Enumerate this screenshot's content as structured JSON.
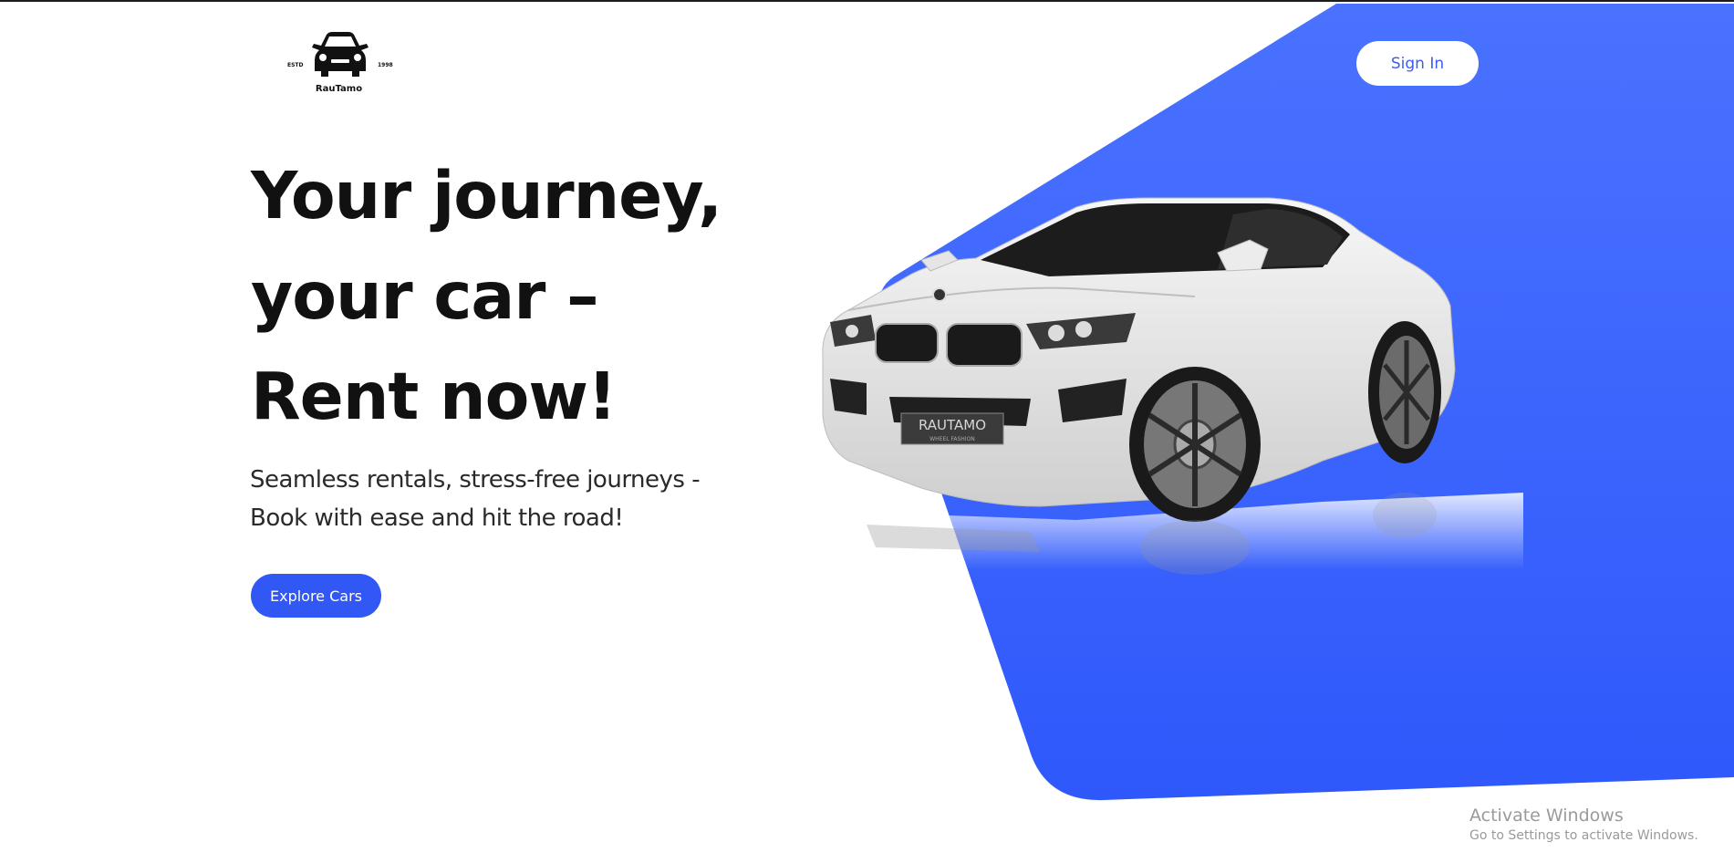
{
  "logo": {
    "estd": "ESTD",
    "year": "1998",
    "brand": "RauTamo",
    "icon": "car-front-icon"
  },
  "header": {
    "sign_in_label": "Sign In"
  },
  "hero": {
    "headline_lines": [
      "Your journey,",
      "your car –",
      "Rent now!"
    ],
    "subtitle_lines": [
      "Seamless rentals, stress-free journeys -",
      "Book with ease and hit the road!"
    ],
    "cta_label": "Explore Cars",
    "plate_text": "RAUTAMO",
    "plate_subtext": "WHEEL FASHION"
  },
  "watermark": {
    "title": "Activate Windows",
    "subtitle": "Go to Settings to activate Windows."
  },
  "colors": {
    "accent": "#3157f5",
    "accent_light": "#4a6cff",
    "text_dark": "#111111",
    "background": "#ffffff"
  }
}
